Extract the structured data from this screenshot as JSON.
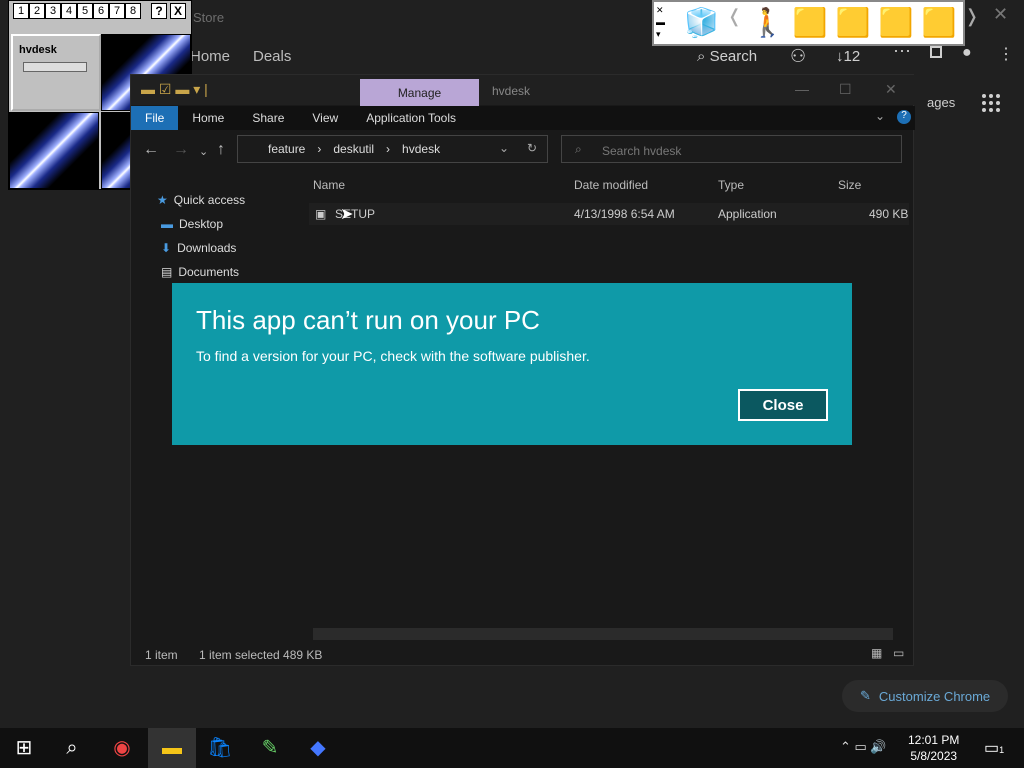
{
  "store": {
    "title": "Store",
    "nav": [
      "Home",
      "Deals"
    ],
    "search": "Search",
    "downloads": "12",
    "ages_label": "ages",
    "customize": "Customize Chrome"
  },
  "vdesk": {
    "numbers": [
      "1",
      "2",
      "3",
      "4",
      "5",
      "6",
      "7",
      "8"
    ],
    "help": "?",
    "close": "X",
    "thumb_label": "hvdesk"
  },
  "explorer": {
    "manage": "Manage",
    "title": "hvdesk",
    "ribbon": [
      "File",
      "Home",
      "Share",
      "View",
      "Application Tools"
    ],
    "breadcrumb": [
      "feature",
      "deskutil",
      "hvdesk"
    ],
    "search_placeholder": "Search hvdesk",
    "columns": [
      "Name",
      "Date modified",
      "Type",
      "Size"
    ],
    "file": {
      "name": "SETUP",
      "date": "4/13/1998 6:54 AM",
      "type": "Application",
      "size": "490 KB"
    },
    "sidebar": [
      "Quick access",
      "Desktop",
      "Downloads",
      "Documents"
    ],
    "status": {
      "items": "1 item",
      "selected": "1 item selected  489 KB"
    }
  },
  "dialog": {
    "title": "This app can’t run on your PC",
    "message": "To find a version for your PC, check with the software publisher.",
    "close": "Close"
  },
  "taskbar": {
    "time": "12:01 PM",
    "date": "5/8/2023",
    "notifications": "1"
  }
}
